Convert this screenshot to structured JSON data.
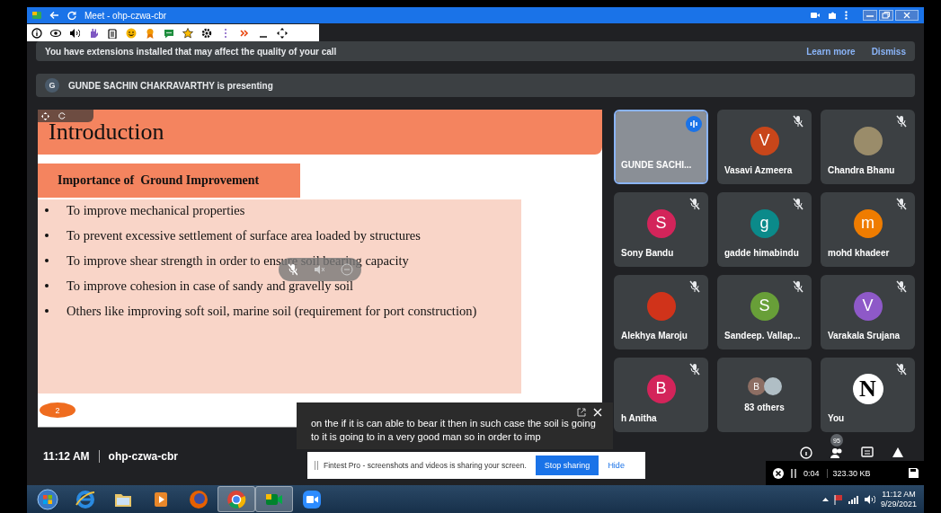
{
  "browser": {
    "title": "Meet - ohp-czwa-cbr"
  },
  "banner": {
    "message": "You have extensions installed that may affect the quality of your call",
    "links": [
      "Learn more",
      "Dismiss"
    ]
  },
  "presenting": {
    "initial": "G",
    "text": "GUNDE SACHIN CHAKRAVARTHY is presenting"
  },
  "slide": {
    "title": "Introduction",
    "subtitle": "Importance of  Ground Improvement",
    "page": "2",
    "bullets": [
      "To improve mechanical properties",
      "To prevent excessive settlement of surface area loaded by structures",
      "To improve shear strength in order to ensure soil bearing capacity",
      "To improve cohesion in case of sandy and gravelly soil",
      "Others like improving soft soil, marine soil (requirement for port construction)"
    ]
  },
  "tiles": [
    {
      "kind": "video",
      "name": "GUNDE SACHI...",
      "muted": false,
      "speaking": true
    },
    {
      "kind": "letter",
      "name": "Vasavi Azmeera",
      "initial": "V",
      "color": "#c8461a",
      "muted": true,
      "speaking": false
    },
    {
      "kind": "photo",
      "name": "Chandra Bhanu",
      "muted": true,
      "speaking": false
    },
    {
      "kind": "letter",
      "name": "Sony Bandu",
      "initial": "S",
      "color": "#d3245a",
      "muted": true,
      "speaking": false
    },
    {
      "kind": "letter",
      "name": "gadde himabindu",
      "initial": "g",
      "color": "#0b8a8a",
      "muted": true,
      "speaking": false
    },
    {
      "kind": "letter",
      "name": "mohd khadeer",
      "initial": "m",
      "color": "#ef7c00",
      "muted": true,
      "speaking": false
    },
    {
      "kind": "photo",
      "name": "Alekhya Maroju",
      "muted": true,
      "speaking": false
    },
    {
      "kind": "letter",
      "name": "Sandeep. Vallap...",
      "initial": "S",
      "color": "#689f38",
      "muted": true,
      "speaking": false
    },
    {
      "kind": "letter",
      "name": "Varakala Srujana",
      "initial": "V",
      "color": "#8e59c8",
      "muted": true,
      "speaking": false
    },
    {
      "kind": "letter",
      "name": "h Anitha",
      "initial": "B",
      "color": "#d3245a",
      "muted": true,
      "speaking": false
    },
    {
      "kind": "others",
      "name": "83 others",
      "initial": "B",
      "color": "#8d6e63",
      "muted": false,
      "speaking": false
    },
    {
      "kind": "logo",
      "name": "You",
      "initial": "N",
      "muted": true,
      "speaking": false
    }
  ],
  "captions": {
    "text": "on the if it is can able to bear it then in such case the soil is going to it is going to in a very good man so in order to imp"
  },
  "meeting": {
    "time": "11:12 AM",
    "code": "ohp-czwa-cbr",
    "badge": "95"
  },
  "share_notice": {
    "message": "Fintest Pro - screenshots and videos is sharing your screen.",
    "button": "Stop sharing",
    "link": "Hide"
  },
  "recorder": {
    "time": "0:04",
    "size": "323.30 KB"
  },
  "taskbar": {
    "apps": [
      {
        "kind": "start",
        "selected": false
      },
      {
        "kind": "ie",
        "selected": false
      },
      {
        "kind": "folder",
        "selected": false
      },
      {
        "kind": "media",
        "selected": false
      },
      {
        "kind": "firefox",
        "selected": false
      },
      {
        "kind": "chrome",
        "selected": true
      },
      {
        "kind": "meet",
        "selected": true
      },
      {
        "kind": "zoom",
        "selected": false
      }
    ],
    "time": "11:12 AM",
    "date": "9/29/2021"
  }
}
